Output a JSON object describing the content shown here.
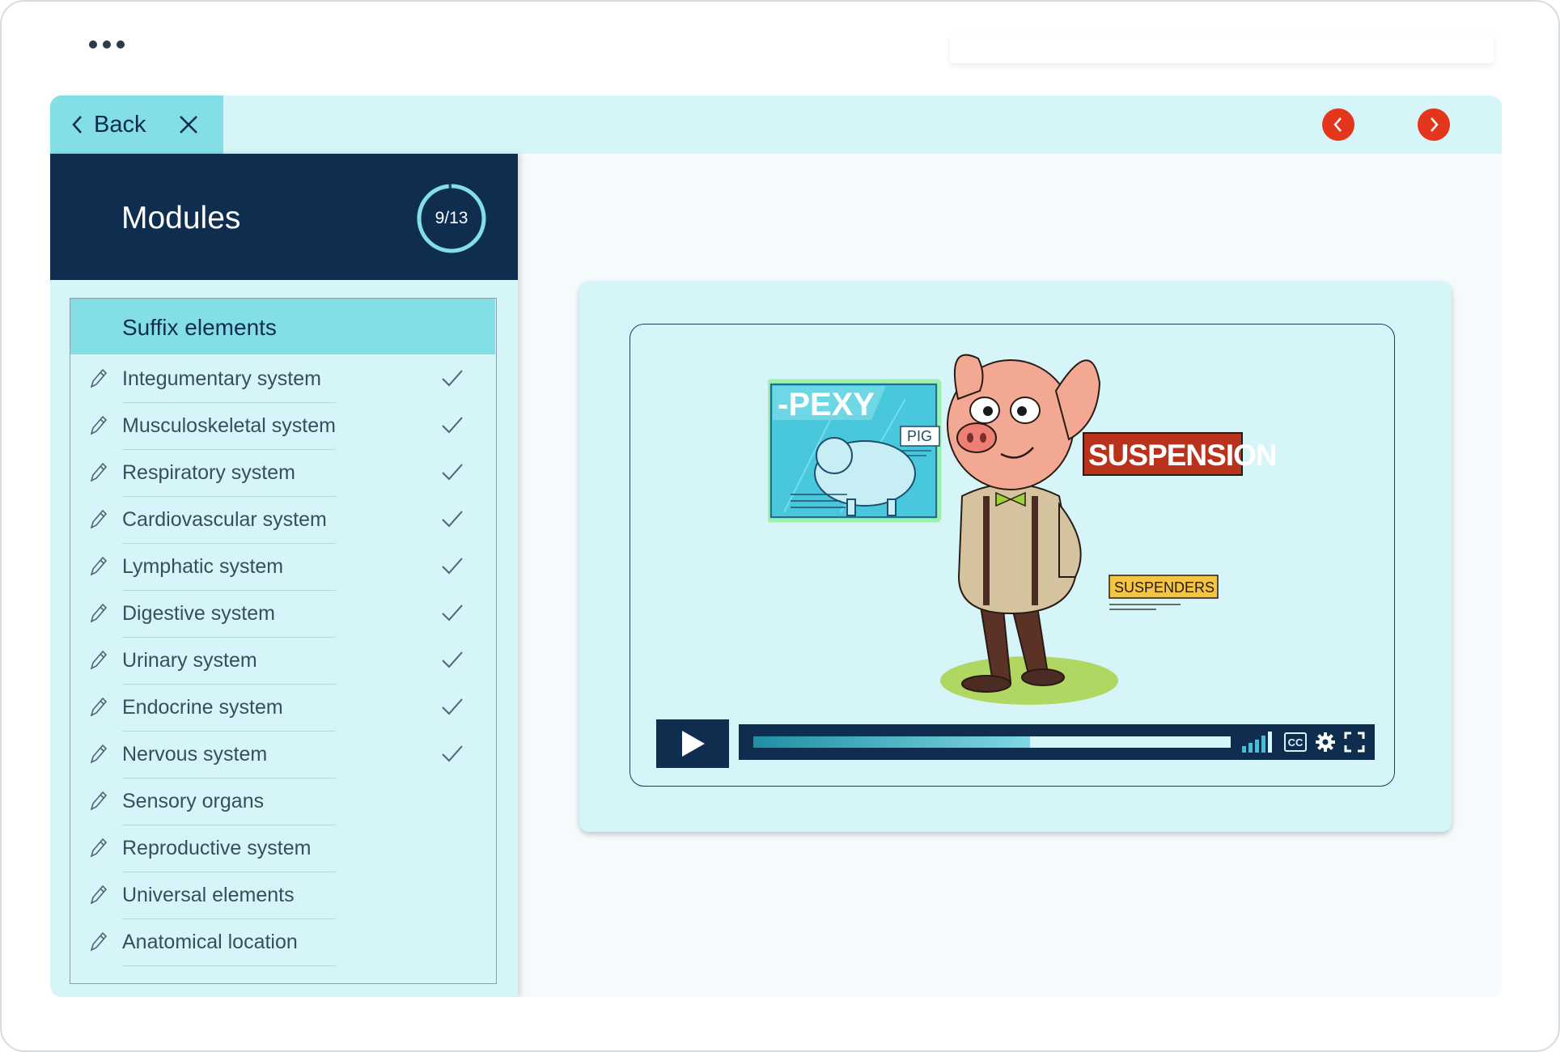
{
  "header": {
    "back_label": "Back"
  },
  "sidebar": {
    "title": "Modules",
    "progress": {
      "label": "9/13",
      "completed": 9,
      "total": 13
    },
    "active_module": "Suffix elements",
    "items": [
      {
        "label": "Integumentary system",
        "done": true
      },
      {
        "label": "Musculoskeletal system",
        "done": true
      },
      {
        "label": "Respiratory system",
        "done": true
      },
      {
        "label": "Cardiovascular system",
        "done": true
      },
      {
        "label": "Lymphatic system",
        "done": true
      },
      {
        "label": "Digestive system",
        "done": true
      },
      {
        "label": "Urinary system",
        "done": true
      },
      {
        "label": "Endocrine system",
        "done": true
      },
      {
        "label": "Nervous system",
        "done": true
      },
      {
        "label": "Sensory organs",
        "done": false
      },
      {
        "label": "Reproductive system",
        "done": false
      },
      {
        "label": "Universal elements",
        "done": false
      },
      {
        "label": "Anatomical location",
        "done": false
      }
    ]
  },
  "video": {
    "illustration": {
      "board_title": "-PEXY",
      "board_label": "PIG",
      "sign_main": "SUSPENSION",
      "sign_small": "SUSPENDERS"
    },
    "progress": 0.58,
    "cc_label": "CC"
  },
  "colors": {
    "navy": "#0e2d4f",
    "aqua": "#84dee6",
    "light_aqua": "#d5f5f8",
    "nav_red": "#e4361c",
    "sign_red": "#b8321c"
  },
  "icons": [
    "more-dots-icon",
    "chevron-left-icon",
    "close-icon",
    "prev-arrow-icon",
    "next-arrow-icon",
    "pencil-icon",
    "check-icon",
    "play-icon",
    "volume-icon",
    "captions-icon",
    "gear-icon",
    "fullscreen-icon"
  ]
}
